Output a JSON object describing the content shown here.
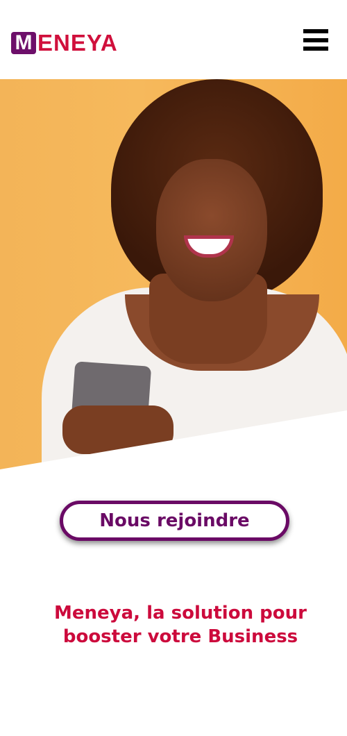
{
  "header": {
    "logo_text": "MENEYA",
    "logo_m": "M",
    "logo_rest": "ENEYA",
    "menu_icon": "hamburger-menu-icon"
  },
  "hero": {
    "image": "smiling woman holding smartphone against orange wall"
  },
  "cta": {
    "label": "Nous rejoindre"
  },
  "tagline": {
    "line1": "Meneya, la solution pour",
    "line2": "booster votre Business"
  },
  "colors": {
    "brand_purple": "#6a0a65",
    "brand_red": "#cc0a3c"
  }
}
